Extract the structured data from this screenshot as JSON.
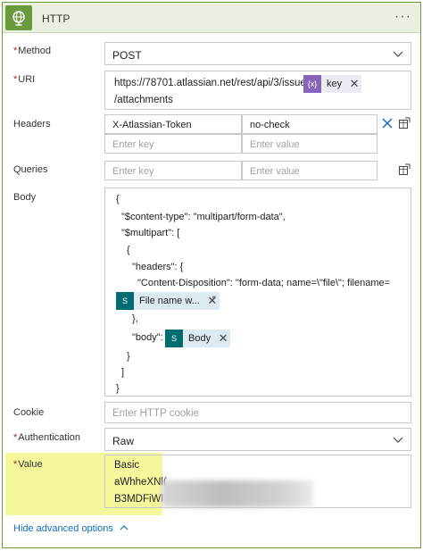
{
  "header": {
    "title": "HTTP",
    "menu": "···",
    "icon": "globe-icon",
    "accent": "#6b9a3e"
  },
  "method": {
    "label": "Method",
    "value": "POST"
  },
  "uri": {
    "label": "URI",
    "text_before": "https://78701.atlassian.net/rest/api/3/issue/",
    "token_label": "key",
    "text_after": "/attachments"
  },
  "headers": {
    "label": "Headers",
    "key": "X-Atlassian-Token",
    "value": "no-check",
    "key_placeholder": "Enter key",
    "value_placeholder": "Enter value"
  },
  "queries": {
    "label": "Queries",
    "key_placeholder": "Enter key",
    "value_placeholder": "Enter value"
  },
  "body": {
    "label": "Body",
    "line1": "{",
    "line2": "\"$content-type\": \"multipart/form-data\",",
    "line3": "\"$multipart\": [",
    "line4": "{",
    "line5": "\"headers\": {",
    "line6": "\"Content-Disposition\": \"form-data; name=\\\"file\\\"; filename=",
    "token_file": "File name w...",
    "line7_after": "\"",
    "line8": "},",
    "line9_before": "\"body\":",
    "token_body": "Body",
    "line10": "}",
    "line11": "]",
    "line12": "}"
  },
  "cookie": {
    "label": "Cookie",
    "placeholder": "Enter HTTP cookie"
  },
  "authentication": {
    "label": "Authentication",
    "value": "Raw"
  },
  "value": {
    "label": "Value",
    "line1": "Basic",
    "line2": "aWhheXNl(",
    "line3": "B3MDFiWl"
  },
  "footer": {
    "hide_advanced": "Hide advanced options"
  },
  "required_mark": "*"
}
